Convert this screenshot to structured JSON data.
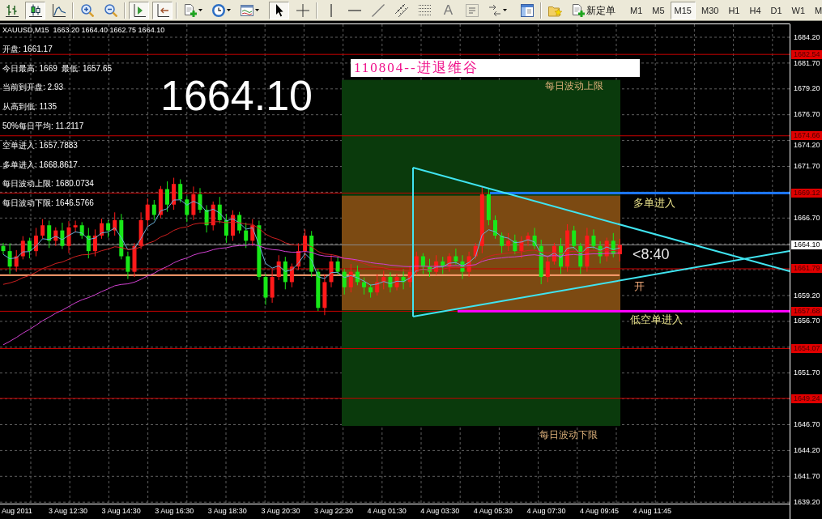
{
  "toolbar": {
    "sections": [
      {
        "groups": [
          [
            {
              "kind": "bars",
              "pressed": false
            },
            {
              "kind": "candles",
              "pressed": true
            },
            {
              "kind": "line",
              "pressed": false
            }
          ],
          [
            {
              "kind": "zoom-in",
              "pressed": false
            },
            {
              "kind": "zoom-out",
              "pressed": false
            }
          ],
          [
            {
              "kind": "shift",
              "pressed": true
            },
            {
              "kind": "scroll",
              "pressed": true
            }
          ],
          [
            {
              "kind": "new-chart",
              "pressed": false
            },
            {
              "kind": "periods",
              "pressed": false
            },
            {
              "kind": "indicators",
              "pressed": false
            }
          ]
        ]
      },
      {
        "groups": [
          [
            {
              "kind": "cursor",
              "pressed": true
            },
            {
              "kind": "crosshair",
              "pressed": false
            }
          ],
          [
            {
              "kind": "vline",
              "pressed": false
            },
            {
              "kind": "hline",
              "pressed": false
            },
            {
              "kind": "trend",
              "pressed": false
            },
            {
              "kind": "channel",
              "pressed": false
            },
            {
              "kind": "fib",
              "pressed": false
            },
            {
              "kind": "text",
              "label": "A",
              "pressed": false
            },
            {
              "kind": "label",
              "pressed": false
            },
            {
              "kind": "arrows",
              "pressed": false
            }
          ]
        ]
      },
      {
        "groups": [
          [
            {
              "kind": "navigator",
              "pressed": false
            }
          ],
          [
            {
              "kind": "experts",
              "pressed": false
            },
            {
              "kind": "new-order",
              "label": "新定单",
              "pressed": false
            }
          ]
        ]
      }
    ],
    "timeframes": [
      {
        "label": "M1",
        "selected": false
      },
      {
        "label": "M5",
        "selected": false
      },
      {
        "label": "M15",
        "selected": true
      },
      {
        "label": "M30",
        "selected": false
      },
      {
        "label": "H1",
        "selected": false
      },
      {
        "label": "H4",
        "selected": false
      },
      {
        "label": "D1",
        "selected": false
      },
      {
        "label": "W1",
        "selected": false
      },
      {
        "label": "M",
        "selected": false
      }
    ]
  },
  "chart": {
    "header": "XAUUSD,M15  1663.20 1664.40 1662.75 1664.10",
    "info_lines": [
      "开盘: 1661.17",
      "今日最高: 1669  最低: 1657.65",
      "当前到开盘: 2.93",
      "从高到低: 1135",
      "50%每日平均: 11.2117",
      "空单进入: 1657.7883",
      "多单进入: 1668.8617",
      "每日波动上限: 1680.0734",
      "每日波动下限: 1646.5766"
    ],
    "big_price": "1664.10",
    "title": "110804--进退维谷",
    "labels": [
      {
        "kind": "zone",
        "text": "每日波动上限"
      },
      {
        "kind": "entry",
        "text": "多单进入"
      },
      {
        "kind": "countdown",
        "text": "<8:40"
      },
      {
        "kind": "open",
        "text": "开"
      },
      {
        "kind": "entry",
        "text": "低空单进入"
      },
      {
        "kind": "zone",
        "text": "每日波动下限"
      }
    ]
  },
  "levels": [
    {
      "tag": "1682.54",
      "kind": "level"
    },
    {
      "tag": "1674.66",
      "kind": "level"
    },
    {
      "tag": "1669.12",
      "kind": "level",
      "color": "#1e78ff"
    },
    {
      "tag": "1664.10",
      "kind": "bid"
    },
    {
      "tag": "1661.79",
      "kind": "level"
    },
    {
      "tag": "1657.68",
      "kind": "level",
      "color": "#ff00ff"
    },
    {
      "tag": "1654.07",
      "kind": "level"
    },
    {
      "tag": "1649.24",
      "kind": "level"
    }
  ],
  "price_axis": {
    "ticks": [
      "1684.20",
      "1681.70",
      "1679.20",
      "1676.70",
      "1674.20",
      "1671.70",
      "1666.70",
      "1659.20",
      "1656.70",
      "1651.70",
      "1646.70",
      "1644.20",
      "1641.70",
      "1639.20"
    ]
  },
  "time_axis": {
    "labels": [
      "Aug 2011",
      "3 Aug 12:30",
      "3 Aug 14:30",
      "3 Aug 16:30",
      "3 Aug 18:30",
      "3 Aug 20:30",
      "3 Aug 22:30",
      "4 Aug 01:30",
      "4 Aug 03:30",
      "4 Aug 05:30",
      "4 Aug 07:30",
      "4 Aug 09:45",
      "4 Aug 11:45"
    ]
  }
}
